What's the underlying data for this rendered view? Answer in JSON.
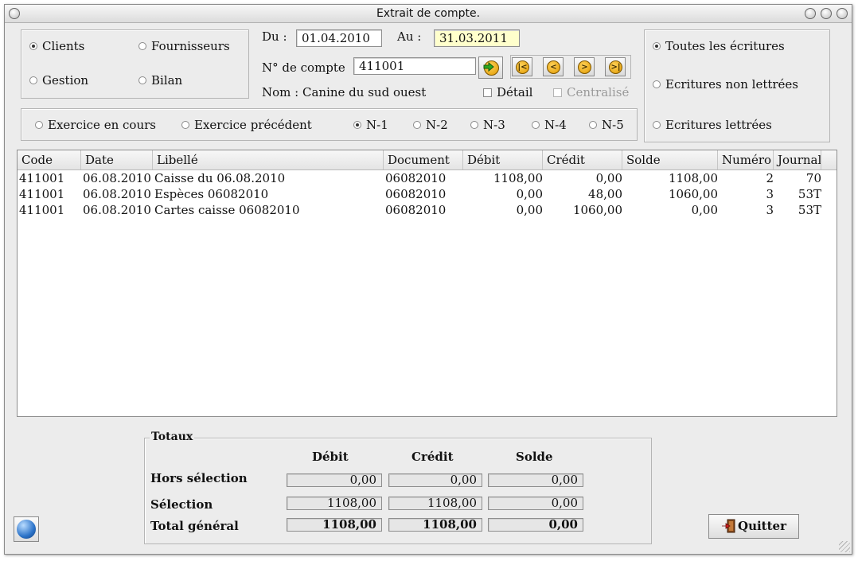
{
  "window": {
    "title": "Extrait de compte."
  },
  "type_group": {
    "clients": "Clients",
    "fournisseurs": "Fournisseurs",
    "gestion": "Gestion",
    "bilan": "Bilan",
    "selected": "clients"
  },
  "filters": {
    "du_label": "Du :",
    "du_value": "01.04.2010",
    "au_label": "Au :",
    "au_value": "31.03.2011",
    "compte_label": "N° de compte",
    "compte_value": "411001",
    "nom_label": "Nom :",
    "nom_value": "Canine du sud ouest",
    "detail_label": "Détail",
    "centralise_label": "Centralisé"
  },
  "nav_icons": [
    "go-arrow-icon",
    "first-record-icon",
    "previous-record-icon",
    "next-record-icon",
    "last-record-icon"
  ],
  "entries_group": {
    "toutes": "Toutes les écritures",
    "non_lettrees": "Ecritures non lettrées",
    "lettrees": "Ecritures lettrées",
    "selected": "toutes"
  },
  "exercice": {
    "en_cours": "Exercice en cours",
    "precedent": "Exercice précédent",
    "n1": "N-1",
    "n2": "N-2",
    "n3": "N-3",
    "n4": "N-4",
    "n5": "N-5",
    "selected": "N-1"
  },
  "table": {
    "columns": [
      "Code",
      "Date",
      "Libellé",
      "Document",
      "Débit",
      "Crédit",
      "Solde",
      "Numéro",
      "Journal"
    ],
    "rows": [
      [
        "411001",
        "06.08.2010",
        "Caisse du 06.08.2010",
        "06082010",
        "1108,00",
        "0,00",
        "1108,00",
        "2",
        "70"
      ],
      [
        "411001",
        "06.08.2010",
        "Espèces 06082010",
        "06082010",
        "0,00",
        "48,00",
        "1060,00",
        "3",
        "53T"
      ],
      [
        "411001",
        "06.08.2010",
        "Cartes caisse 06082010",
        "06082010",
        "0,00",
        "1060,00",
        "0,00",
        "3",
        "53T"
      ]
    ]
  },
  "totals": {
    "title": "Totaux",
    "col_debit": "Débit",
    "col_credit": "Crédit",
    "col_solde": "Solde",
    "hors_label": "Hors sélection",
    "hors": [
      "0,00",
      "0,00",
      "0,00"
    ],
    "sel_label": "Sélection",
    "sel": [
      "1108,00",
      "1108,00",
      "0,00"
    ],
    "total_label": "Total général",
    "total": [
      "1108,00",
      "1108,00",
      "0,00"
    ]
  },
  "buttons": {
    "quit": "Quitter"
  },
  "colors": {
    "highlight_field": "#ffffcc",
    "window_bg": "#ececec"
  }
}
